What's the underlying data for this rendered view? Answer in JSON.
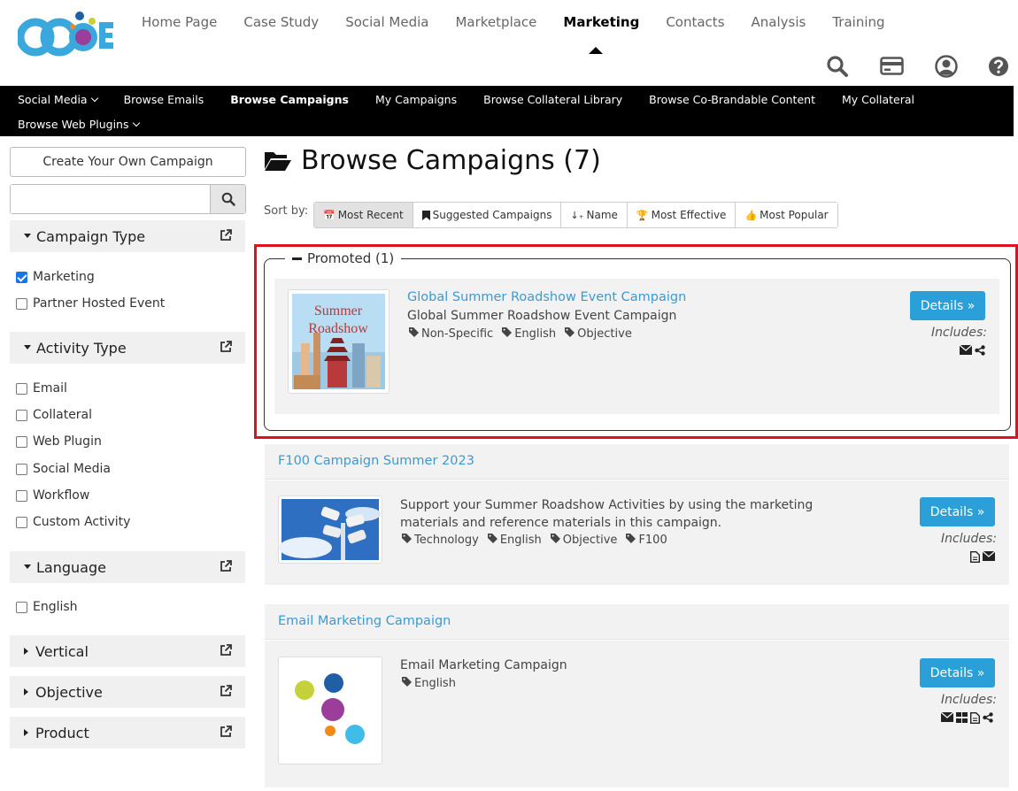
{
  "logo": {
    "text": "CCOE",
    "colors": [
      "#3aa8dc",
      "#1e5fa6",
      "#9b3d9a",
      "#c5d13a",
      "#f08a1c"
    ]
  },
  "topnav": {
    "items": [
      {
        "label": "Home Page"
      },
      {
        "label": "Case Study"
      },
      {
        "label": "Social Media"
      },
      {
        "label": "Marketplace"
      },
      {
        "label": "Marketing",
        "active": true
      },
      {
        "label": "Contacts"
      },
      {
        "label": "Analysis"
      },
      {
        "label": "Training"
      }
    ]
  },
  "header_icons": [
    "search-icon",
    "credit-card-icon",
    "user-account-icon",
    "help-icon"
  ],
  "subnav": {
    "row1": [
      {
        "label": "Social Media",
        "dropdown": true
      },
      {
        "label": "Browse Emails"
      },
      {
        "label": "Browse Campaigns",
        "active": true
      },
      {
        "label": "My Campaigns"
      },
      {
        "label": "Browse Collateral Library"
      },
      {
        "label": "Browse Co-Brandable Content"
      },
      {
        "label": "My Collateral"
      }
    ],
    "row2": [
      {
        "label": "Browse Web Plugins",
        "dropdown": true
      }
    ]
  },
  "sidebar": {
    "create_label": "Create Your Own Campaign",
    "search_placeholder": "",
    "campaign_type": {
      "title": "Campaign Type",
      "options": [
        {
          "label": "Marketing",
          "checked": true
        },
        {
          "label": "Partner Hosted Event",
          "checked": false
        }
      ]
    },
    "activity_type": {
      "title": "Activity Type",
      "options": [
        {
          "label": "Email"
        },
        {
          "label": "Collateral"
        },
        {
          "label": "Web Plugin"
        },
        {
          "label": "Social Media"
        },
        {
          "label": "Workflow"
        },
        {
          "label": "Custom Activity"
        }
      ]
    },
    "language": {
      "title": "Language",
      "options": [
        {
          "label": "English"
        }
      ]
    },
    "collapsed": [
      {
        "title": "Vertical"
      },
      {
        "title": "Objective"
      },
      {
        "title": "Product"
      }
    ]
  },
  "main": {
    "title": "Browse Campaigns (7)",
    "sort_label": "Sort by:",
    "sort_options": [
      {
        "label": "Most Recent",
        "icon": "calendar-icon",
        "active": true
      },
      {
        "label": "Suggested Campaigns",
        "icon": "bookmark-icon"
      },
      {
        "label": "Name",
        "icon": "sort-alpha-icon"
      },
      {
        "label": "Most Effective",
        "icon": "trophy-icon"
      },
      {
        "label": "Most Popular",
        "icon": "thumbs-up-icon"
      }
    ],
    "promoted": {
      "legend": "Promoted (1)",
      "campaign": {
        "title": "Global Summer Roadshow Event Campaign",
        "description": "Global Summer Roadshow Event Campaign",
        "image_text": [
          "Summer",
          "Roadshow"
        ],
        "tags": [
          "Non-Specific",
          "English",
          "Objective"
        ],
        "details_label": "Details »",
        "includes_label": "Includes:",
        "includes_icons": [
          "envelope-icon",
          "share-icon"
        ]
      }
    },
    "campaigns": [
      {
        "title": "F100 Campaign Summer 2023",
        "description": "Support your Summer Roadshow Activities by using the marketing materials and reference materials in this campaign.",
        "tags": [
          "Technology",
          "English",
          "Objective",
          "F100"
        ],
        "details_label": "Details »",
        "includes_label": "Includes:",
        "includes_icons": [
          "document-icon",
          "envelope-icon"
        ]
      },
      {
        "title": "Email Marketing Campaign",
        "description": "Email Marketing Campaign",
        "tags": [
          "English"
        ],
        "details_label": "Details »",
        "includes_label": "Includes:",
        "includes_icons": [
          "envelope-icon",
          "grid-icon",
          "document-icon",
          "share-icon"
        ]
      }
    ]
  },
  "colors": {
    "link": "#3d9ad1",
    "details_button": "#2a9fd8",
    "highlight": "#e0101f",
    "checkbox": "#1a73e8"
  }
}
